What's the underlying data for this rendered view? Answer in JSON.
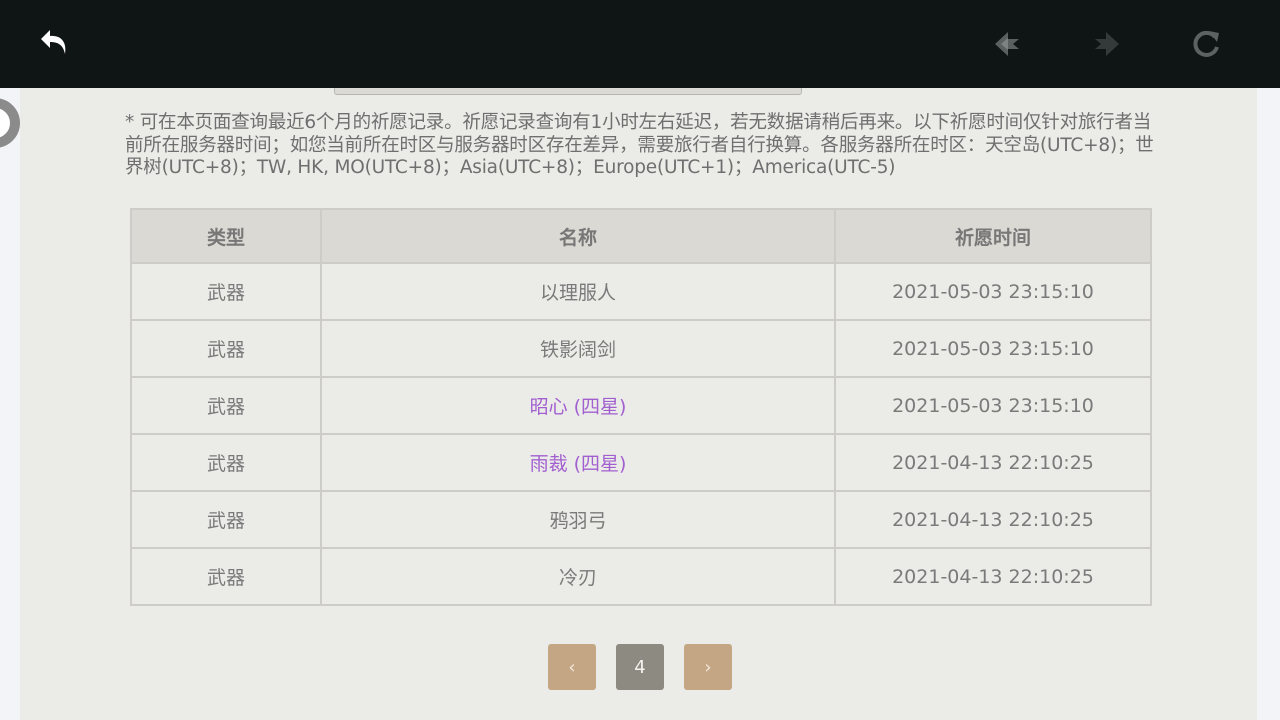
{
  "notice": "* 可在本页面查询最近6个月的祈愿记录。祈愿记录查询有1小时左右延迟，若无数据请稍后再来。以下祈愿时间仅针对旅行者当前所在服务器时间；如您当前所在时区与服务器时区存在差异，需要旅行者自行换算。各服务器所在时区：天空岛(UTC+8)；世界树(UTC+8)；TW, HK, MO(UTC+8)；Asia(UTC+8)；Europe(UTC+1)；America(UTC-5)",
  "table": {
    "headers": [
      "类型",
      "名称",
      "祈愿时间"
    ],
    "rows": [
      {
        "type": "武器",
        "name": "以理服人",
        "time": "2021-05-03 23:15:10",
        "rarity": "normal"
      },
      {
        "type": "武器",
        "name": "铁影阔剑",
        "time": "2021-05-03 23:15:10",
        "rarity": "normal"
      },
      {
        "type": "武器",
        "name": "昭心 (四星)",
        "time": "2021-05-03 23:15:10",
        "rarity": "four-star"
      },
      {
        "type": "武器",
        "name": "雨裁 (四星)",
        "time": "2021-04-13 22:10:25",
        "rarity": "four-star"
      },
      {
        "type": "武器",
        "name": "鸦羽弓",
        "time": "2021-04-13 22:10:25",
        "rarity": "normal"
      },
      {
        "type": "武器",
        "name": "冷刃",
        "time": "2021-04-13 22:10:25",
        "rarity": "normal"
      }
    ]
  },
  "pagination": {
    "prev_label": "‹",
    "current_page": "4",
    "next_label": "›"
  },
  "toolbar": {
    "icons": [
      "back-arrow-icon",
      "prev-page-icon",
      "next-page-icon",
      "refresh-icon"
    ]
  },
  "colors": {
    "four_star": "#a25fd0",
    "pager_button": "#c4a684",
    "pager_current": "#8d8a82"
  }
}
